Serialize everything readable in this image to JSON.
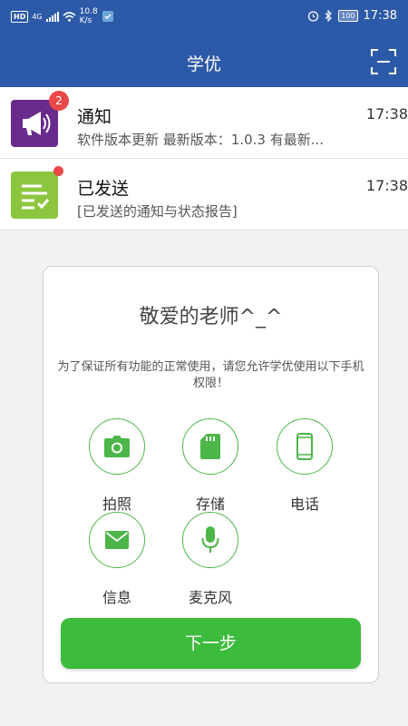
{
  "status_bar": {
    "hd_label": "HD",
    "network_label": "4G",
    "speed_value": "10.8",
    "speed_unit": "K/s",
    "battery": "100",
    "time": "17:38"
  },
  "app_bar": {
    "title": "学优",
    "scan_icon": "scan-frame-icon"
  },
  "notifications": [
    {
      "icon": "megaphone-icon",
      "icon_color": "#6a2c8c",
      "badge": "2",
      "title": "通知",
      "subtitle": "软件版本更新 最新版本：1.0.3 有最新...",
      "time": "17:38"
    },
    {
      "icon": "checklist-icon",
      "icon_color": "#8cc63f",
      "title": "已发送",
      "subtitle": "[已发送的通知与状态报告]",
      "time": "17:38"
    }
  ],
  "permission_card": {
    "title": "敬爱的老师^_^",
    "description": "为了保证所有功能的正常使用，请您允许学优使用以下手机权限！",
    "permissions": [
      {
        "label": "拍照",
        "icon": "camera-icon"
      },
      {
        "label": "存储",
        "icon": "sd-card-icon"
      },
      {
        "label": "电话",
        "icon": "phone-icon"
      },
      {
        "label": "信息",
        "icon": "envelope-icon"
      },
      {
        "label": "麦克风",
        "icon": "microphone-icon"
      }
    ],
    "next_button": "下一步"
  },
  "colors": {
    "primary_blue": "#2d5aa8",
    "accent_green": "#3dbb3d",
    "badge_red": "#e84848"
  }
}
